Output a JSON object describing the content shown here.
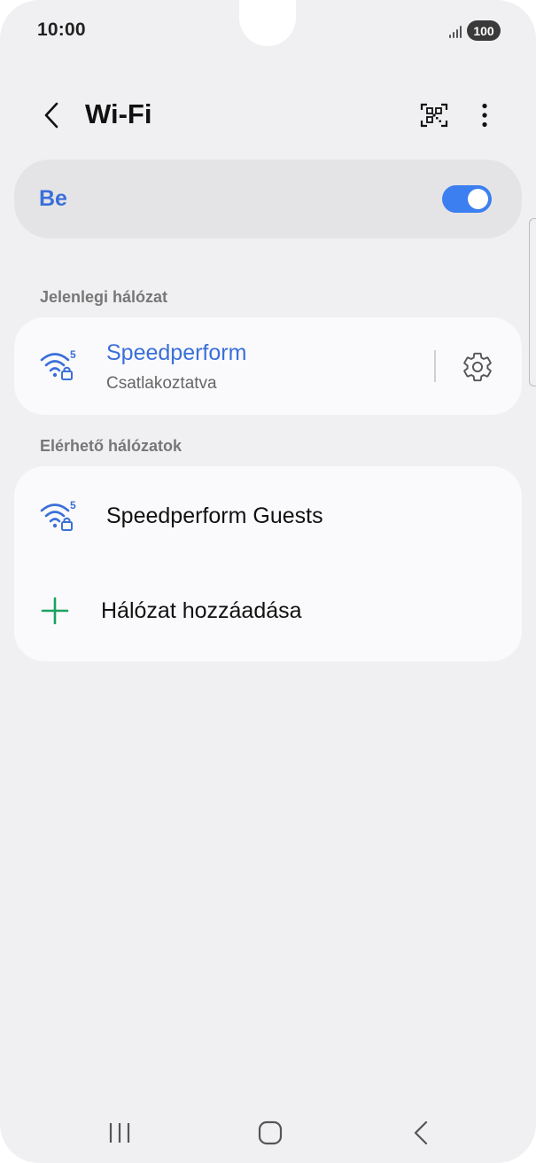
{
  "status_bar": {
    "time": "10:00",
    "battery": "100",
    "signal_icon": "signal-icon"
  },
  "header": {
    "title": "Wi-Fi",
    "back_icon": "chevron-left-icon",
    "qr_icon": "qr-scan-icon",
    "more_icon": "more-vertical-icon"
  },
  "master_switch": {
    "label": "Be",
    "state": "on",
    "accent_color": "#3b7ff0"
  },
  "current_network": {
    "section_label": "Jelenlegi hálózat",
    "name": "Speedperform",
    "status": "Csatlakoztatva",
    "band": "5",
    "icon": "wifi-secured-icon",
    "settings_icon": "gear-icon"
  },
  "available_networks": {
    "section_label": "Elérhető hálózatok",
    "items": [
      {
        "name": "Speedperform Guests",
        "band": "5",
        "icon": "wifi-secured-icon"
      }
    ],
    "add_label": "Hálózat hozzáadása",
    "add_icon": "plus-icon"
  },
  "nav_bar": {
    "recents_icon": "recents-icon",
    "home_icon": "home-icon",
    "back_icon": "back-icon"
  },
  "colors": {
    "accent_blue": "#3b6fd8",
    "plus_green": "#1aa260",
    "background": "#f0f0f2"
  }
}
